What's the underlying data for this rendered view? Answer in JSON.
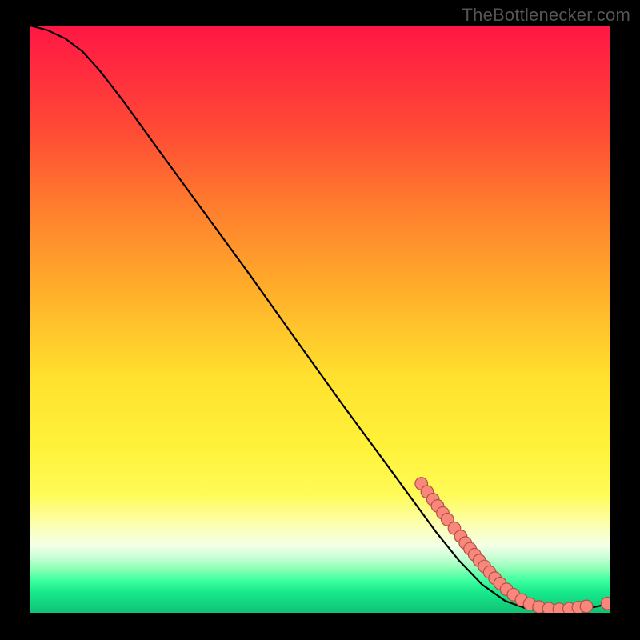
{
  "attribution": "TheBottlenecker.com",
  "chart_data": {
    "type": "line",
    "title": "",
    "xlabel": "",
    "ylabel": "",
    "xlim": [
      0,
      100
    ],
    "ylim": [
      0,
      100
    ],
    "gradient_stops": [
      {
        "pos": 0.0,
        "color": "#ff1744"
      },
      {
        "pos": 0.07,
        "color": "#ff2a3f"
      },
      {
        "pos": 0.18,
        "color": "#ff4b35"
      },
      {
        "pos": 0.3,
        "color": "#ff7a2e"
      },
      {
        "pos": 0.45,
        "color": "#ffae2a"
      },
      {
        "pos": 0.6,
        "color": "#ffe12e"
      },
      {
        "pos": 0.72,
        "color": "#fff23a"
      },
      {
        "pos": 0.8,
        "color": "#fffb58"
      },
      {
        "pos": 0.85,
        "color": "#fcffb0"
      },
      {
        "pos": 0.885,
        "color": "#f4ffe6"
      },
      {
        "pos": 0.905,
        "color": "#c9ffd6"
      },
      {
        "pos": 0.925,
        "color": "#8dffb6"
      },
      {
        "pos": 0.945,
        "color": "#3dffa0"
      },
      {
        "pos": 0.965,
        "color": "#17e98c"
      },
      {
        "pos": 1.0,
        "color": "#0fc274"
      }
    ],
    "curve": [
      {
        "x": 0,
        "y": 100.0
      },
      {
        "x": 3,
        "y": 99.2
      },
      {
        "x": 6,
        "y": 97.8
      },
      {
        "x": 9,
        "y": 95.6
      },
      {
        "x": 12,
        "y": 92.3
      },
      {
        "x": 16,
        "y": 87.2
      },
      {
        "x": 22,
        "y": 79.0
      },
      {
        "x": 30,
        "y": 68.2
      },
      {
        "x": 38,
        "y": 57.4
      },
      {
        "x": 46,
        "y": 46.3
      },
      {
        "x": 54,
        "y": 35.3
      },
      {
        "x": 62,
        "y": 24.6
      },
      {
        "x": 66,
        "y": 19.2
      },
      {
        "x": 70,
        "y": 13.8
      },
      {
        "x": 74,
        "y": 8.9
      },
      {
        "x": 78,
        "y": 4.8
      },
      {
        "x": 82,
        "y": 2.0
      },
      {
        "x": 86,
        "y": 0.6
      },
      {
        "x": 90,
        "y": 0.2
      },
      {
        "x": 94,
        "y": 0.4
      },
      {
        "x": 98,
        "y": 1.1
      },
      {
        "x": 100,
        "y": 1.6
      }
    ],
    "markers": [
      {
        "x": 67.5,
        "y": 22.0
      },
      {
        "x": 68.5,
        "y": 20.6
      },
      {
        "x": 69.5,
        "y": 19.3
      },
      {
        "x": 70.3,
        "y": 18.2
      },
      {
        "x": 71.2,
        "y": 17.0
      },
      {
        "x": 72.0,
        "y": 15.9
      },
      {
        "x": 73.2,
        "y": 14.4
      },
      {
        "x": 74.3,
        "y": 13.0
      },
      {
        "x": 75.1,
        "y": 11.9
      },
      {
        "x": 75.9,
        "y": 10.9
      },
      {
        "x": 76.7,
        "y": 9.9
      },
      {
        "x": 77.5,
        "y": 8.9
      },
      {
        "x": 78.4,
        "y": 7.9
      },
      {
        "x": 79.3,
        "y": 6.9
      },
      {
        "x": 80.2,
        "y": 5.9
      },
      {
        "x": 81.1,
        "y": 5.0
      },
      {
        "x": 82.2,
        "y": 4.0
      },
      {
        "x": 83.4,
        "y": 3.1
      },
      {
        "x": 84.8,
        "y": 2.2
      },
      {
        "x": 86.2,
        "y": 1.5
      },
      {
        "x": 87.8,
        "y": 1.0
      },
      {
        "x": 89.5,
        "y": 0.7
      },
      {
        "x": 91.3,
        "y": 0.6
      },
      {
        "x": 93.0,
        "y": 0.7
      },
      {
        "x": 94.6,
        "y": 0.9
      },
      {
        "x": 96.0,
        "y": 1.1
      },
      {
        "x": 99.6,
        "y": 1.6
      }
    ],
    "marker_style": {
      "r": 7.8,
      "fill": "#fa877c",
      "stroke": "#b15047",
      "stroke_width": 1.2
    }
  }
}
